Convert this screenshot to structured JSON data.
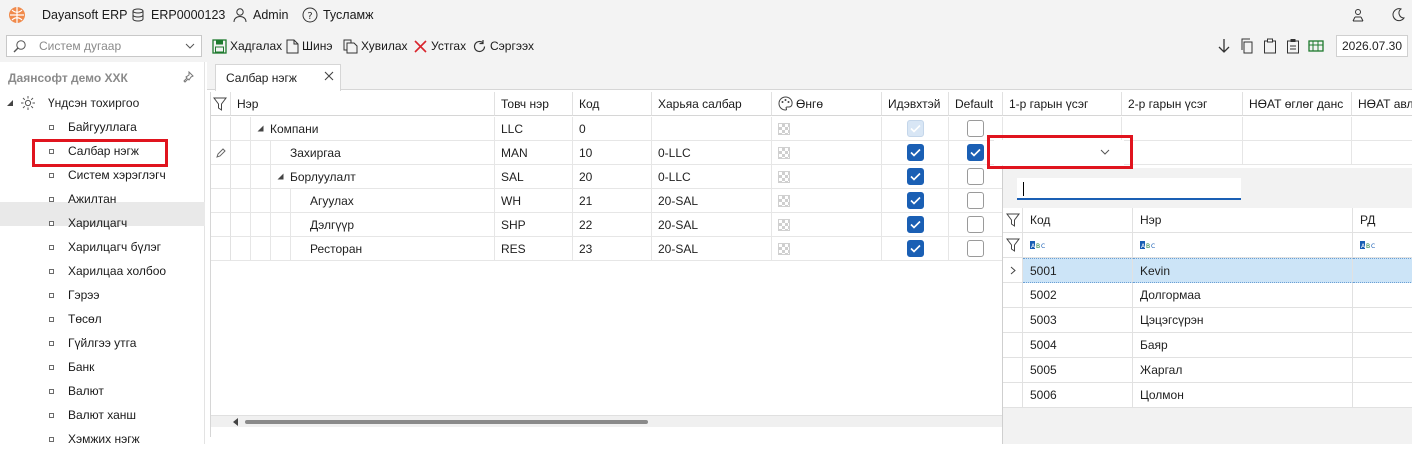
{
  "titlebar": {
    "app_name": "Dayansoft ERP",
    "db_code": "ERP0000123",
    "user": "Admin",
    "help": "Тусламж"
  },
  "toolbar": {
    "search_placeholder": "Систем дугаар",
    "save": "Хадгалах",
    "new": "Шинэ",
    "copy": "Хувилах",
    "delete": "Устгах",
    "refresh": "Сэргээх",
    "date": "2026.07.30"
  },
  "sidebar": {
    "company": "Даянсофт демо ХХК",
    "root": "Үндсэн тохиргоо",
    "items": [
      "Байгууллага",
      "Салбар нэгж",
      "Систем хэрэглэгч",
      "Ажилтан",
      "Харилцагч",
      "Харилцагч бүлэг",
      "Харилцаа холбоо",
      "Гэрээ",
      "Төсөл",
      "Гүйлгээ утга",
      "Банк",
      "Валют",
      "Валют ханш",
      "Хэмжих нэгж"
    ]
  },
  "tab": {
    "label": "Салбар нэгж"
  },
  "grid": {
    "headers": [
      "Нэр",
      "Товч нэр",
      "Код",
      "Харьяа салбар",
      "Өнгө",
      "Идэвхтэй",
      "Default",
      "1-р гарын үсэг",
      "2-р гарын үсэг",
      "НӨАТ өглөг данс",
      "НӨАТ авл"
    ],
    "rows": [
      {
        "name": "Компани",
        "short": "LLC",
        "code": "0",
        "parent": "",
        "active": "disabled",
        "default": false
      },
      {
        "name": "Захиргаа",
        "short": "MAN",
        "code": "10",
        "parent": "0-LLC",
        "active": true,
        "default": true
      },
      {
        "name": "Борлуулалт",
        "short": "SAL",
        "code": "20",
        "parent": "0-LLC",
        "active": true,
        "default": false
      },
      {
        "name": "Агуулах",
        "short": "WH",
        "code": "21",
        "parent": "20-SAL",
        "active": true,
        "default": false
      },
      {
        "name": "Дэлгүүр",
        "short": "SHP",
        "code": "22",
        "parent": "20-SAL",
        "active": true,
        "default": false
      },
      {
        "name": "Ресторан",
        "short": "RES",
        "code": "23",
        "parent": "20-SAL",
        "active": true,
        "default": false
      }
    ]
  },
  "popup": {
    "headers": [
      "Код",
      "Нэр",
      "РД"
    ],
    "rows": [
      {
        "code": "5001",
        "name": "Kevin"
      },
      {
        "code": "5002",
        "name": "Долгормаа"
      },
      {
        "code": "5003",
        "name": "Цэцэгсүрэн"
      },
      {
        "code": "5004",
        "name": "Баяр"
      },
      {
        "code": "5005",
        "name": "Жаргал"
      },
      {
        "code": "5006",
        "name": "Цолмон"
      }
    ]
  },
  "colors": {
    "accent": "#1a5fb4",
    "highlight": "#e0141e",
    "selected_row": "#cce4f7"
  }
}
